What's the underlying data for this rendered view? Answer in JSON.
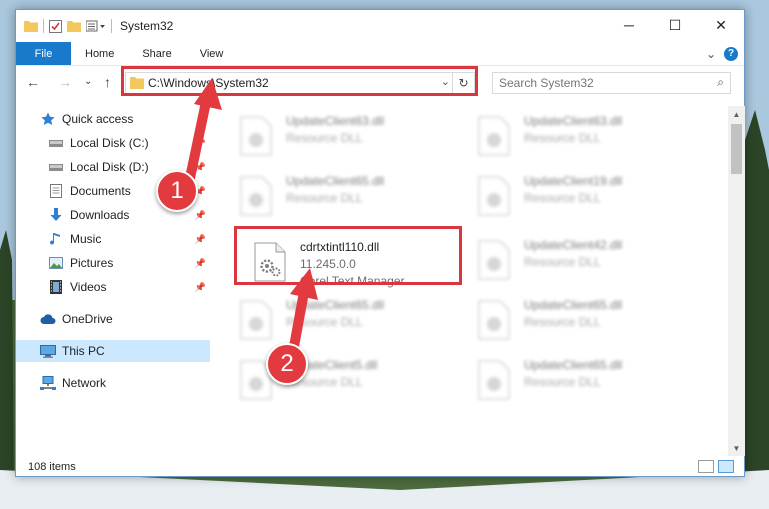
{
  "window": {
    "title": "System32",
    "controls": {
      "minimize": "─",
      "maximize": "☐",
      "close": "✕"
    }
  },
  "ribbon": {
    "tabs": [
      {
        "label": "File"
      },
      {
        "label": "Home"
      },
      {
        "label": "Share"
      },
      {
        "label": "View"
      }
    ],
    "collapse_glyph": "⌄",
    "help_glyph": "?"
  },
  "addressbar": {
    "back_glyph": "←",
    "forward_glyph": "→",
    "recent_glyph": "⌄",
    "up_glyph": "↑",
    "path": "C:\\Windows\\System32",
    "dropdown_glyph": "⌄",
    "refresh_glyph": "↻"
  },
  "search": {
    "placeholder": "Search System32",
    "icon_glyph": "⌕"
  },
  "navpane": {
    "items": [
      {
        "label": "Quick access",
        "icon": "star-icon"
      },
      {
        "label": "Local Disk (C:)",
        "icon": "drive-icon",
        "pinned": true
      },
      {
        "label": "Local Disk (D:)",
        "icon": "drive-icon",
        "pinned": true
      },
      {
        "label": "Documents",
        "icon": "documents-icon",
        "pinned": true
      },
      {
        "label": "Downloads",
        "icon": "download-icon",
        "pinned": true
      },
      {
        "label": "Music",
        "icon": "music-icon",
        "pinned": true
      },
      {
        "label": "Pictures",
        "icon": "pictures-icon",
        "pinned": true
      },
      {
        "label": "Videos",
        "icon": "videos-icon",
        "pinned": true
      },
      {
        "label": "OneDrive",
        "icon": "cloud-icon"
      },
      {
        "label": "This PC",
        "icon": "computer-icon",
        "selected": true
      },
      {
        "label": "Network",
        "icon": "network-icon"
      }
    ],
    "pin_glyph": "📌"
  },
  "files": {
    "highlighted": {
      "name": "cdrtxtintl110.dll",
      "version": "11.245.0.0",
      "description": "Corel Text Manager ..."
    },
    "blurred": [
      {
        "name": "UpdateClient63.dll",
        "type": "Resource DLL"
      },
      {
        "name": "UpdateClient63.dll",
        "type": "Resource DLL"
      },
      {
        "name": "UpdateClient65.dll",
        "type": "Resource DLL"
      },
      {
        "name": "UpdateClient19.dll",
        "type": "Resource DLL"
      },
      {
        "name": "UpdateClient42.dll",
        "type": "Resource DLL"
      },
      {
        "name": "UpdateClient65.dll",
        "type": "Resource DLL"
      },
      {
        "name": "UpdateClient65.dll",
        "type": "Resource DLL"
      },
      {
        "name": "UpdateClient65.dll",
        "type": "Resource DLL"
      },
      {
        "name": "UpdateClient5.dll",
        "type": "Resource DLL"
      },
      {
        "name": "UpdateClient65.dll",
        "type": "Resource DLL"
      }
    ]
  },
  "scrollbar": {
    "up_glyph": "▲",
    "down_glyph": "▼"
  },
  "status": {
    "item_count": "108 items"
  },
  "annotations": {
    "step1": "1",
    "step2": "2",
    "color": "#e23a3f"
  }
}
